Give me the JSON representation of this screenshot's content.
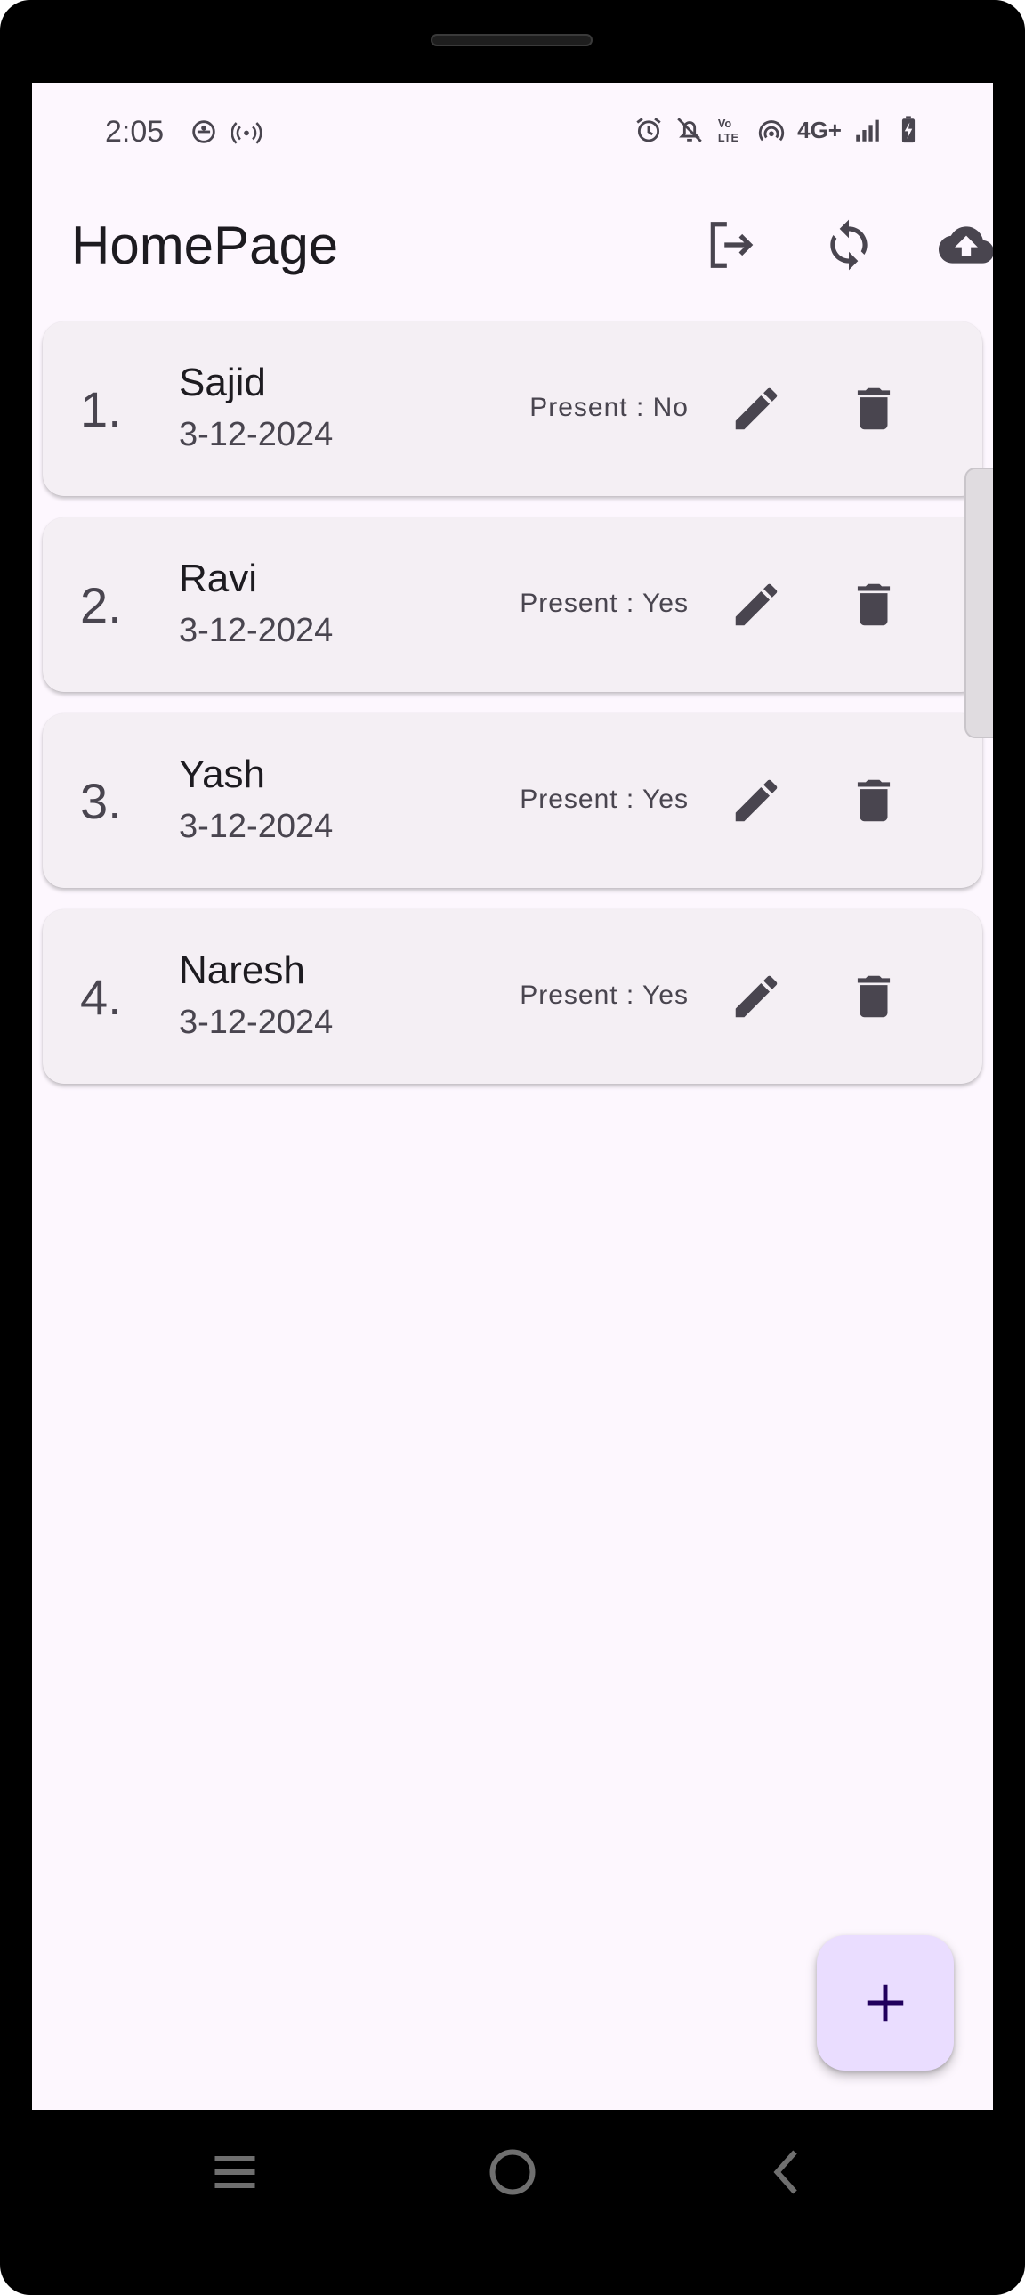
{
  "status_bar": {
    "time": "2:05",
    "network": "4G+"
  },
  "app_bar": {
    "title": "HomePage",
    "actions": [
      "logout-icon",
      "sync-icon",
      "cloud-upload-icon"
    ]
  },
  "attendance": [
    {
      "index": "1.",
      "name": "Sajid",
      "date": "3-12-2024",
      "present": "Present : No"
    },
    {
      "index": "2.",
      "name": "Ravi",
      "date": "3-12-2024",
      "present": "Present : Yes"
    },
    {
      "index": "3.",
      "name": "Yash",
      "date": "3-12-2024",
      "present": "Present : Yes"
    },
    {
      "index": "4.",
      "name": "Naresh",
      "date": "3-12-2024",
      "present": "Present : Yes"
    }
  ],
  "fab": {
    "icon": "add-icon"
  },
  "nav_bar": {
    "buttons": [
      "recent-apps-icon",
      "home-icon",
      "back-icon"
    ]
  },
  "colors": {
    "background": "#fdf7fe",
    "card": "#f4eff4",
    "icon": "#49454f",
    "fab": "#eaddff",
    "fab_icon": "#21005d"
  }
}
